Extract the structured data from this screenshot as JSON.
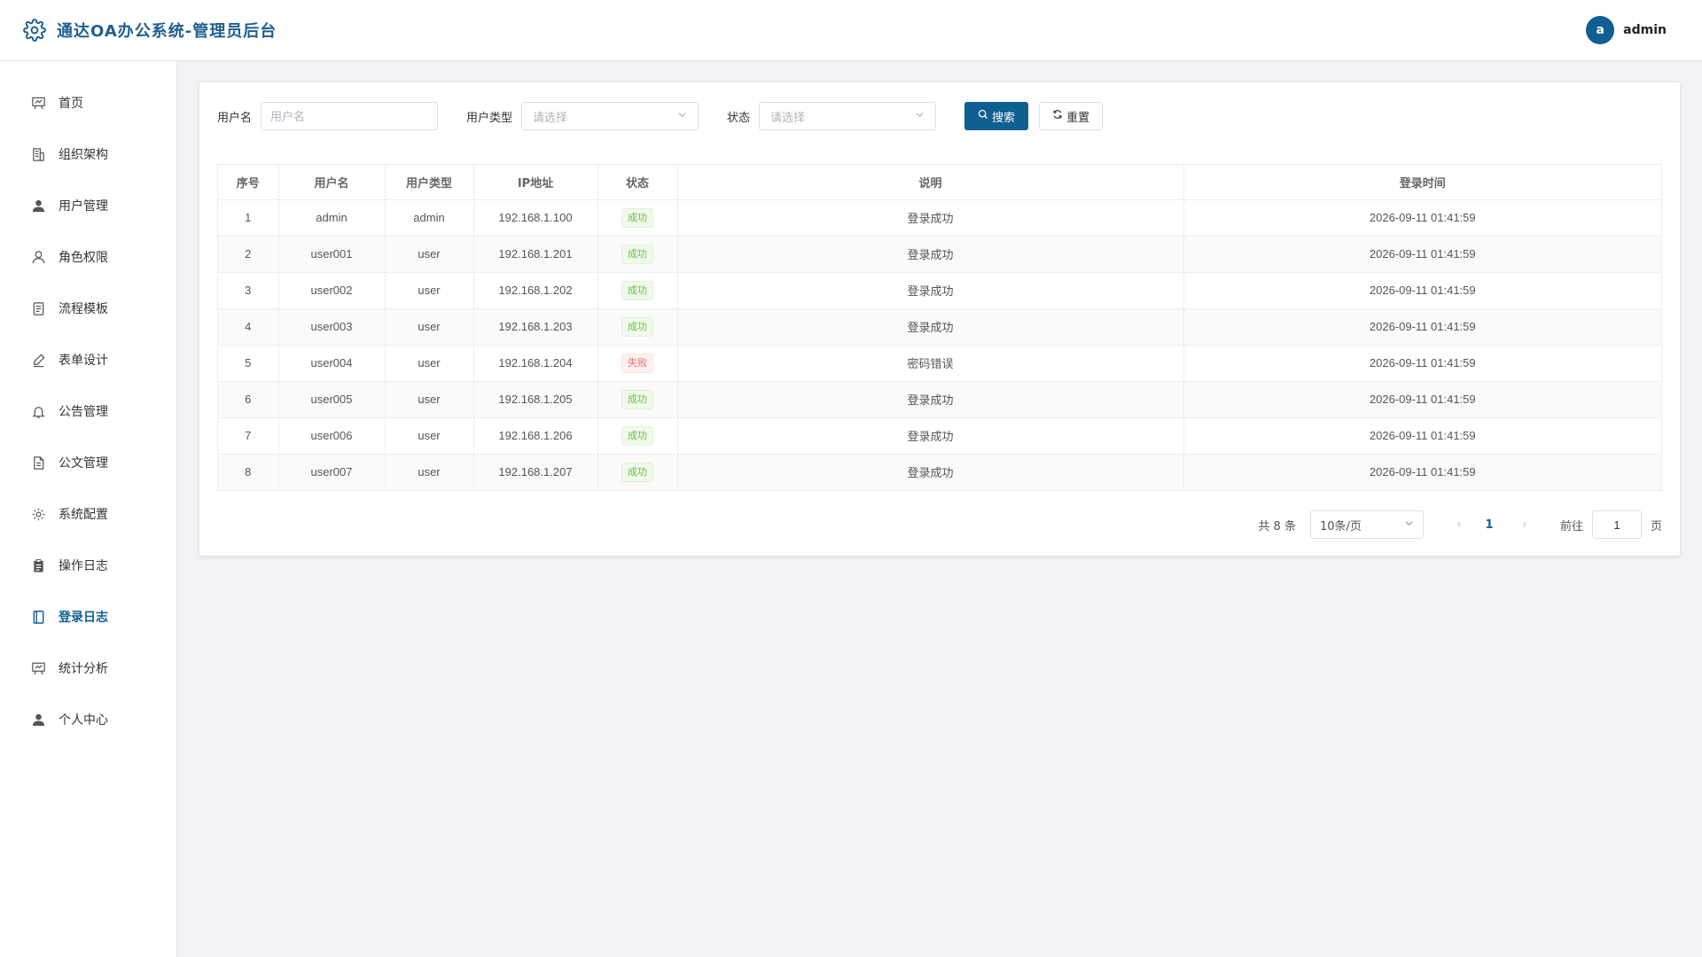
{
  "header": {
    "title": "通达OA办公系统-管理员后台",
    "user": {
      "avatar_letter": "a",
      "name": "admin"
    }
  },
  "sidebar": {
    "items": [
      {
        "label": "首页",
        "icon": "dashboard-icon"
      },
      {
        "label": "组织架构",
        "icon": "building-icon"
      },
      {
        "label": "用户管理",
        "icon": "user-filled-icon"
      },
      {
        "label": "角色权限",
        "icon": "user-outline-icon"
      },
      {
        "label": "流程模板",
        "icon": "document-icon"
      },
      {
        "label": "表单设计",
        "icon": "pen-icon"
      },
      {
        "label": "公告管理",
        "icon": "bell-icon"
      },
      {
        "label": "公文管理",
        "icon": "file-text-icon"
      },
      {
        "label": "系统配置",
        "icon": "gear-icon"
      },
      {
        "label": "操作日志",
        "icon": "clipboard-icon"
      },
      {
        "label": "登录日志",
        "icon": "notebook-icon",
        "active": true
      },
      {
        "label": "统计分析",
        "icon": "chart-board-icon"
      },
      {
        "label": "个人中心",
        "icon": "user-filled-icon"
      }
    ]
  },
  "filters": {
    "username": {
      "label": "用户名",
      "placeholder": "用户名",
      "value": ""
    },
    "user_type": {
      "label": "用户类型",
      "placeholder": "请选择"
    },
    "status": {
      "label": "状态",
      "placeholder": "请选择"
    },
    "search_label": "搜索",
    "reset_label": "重置"
  },
  "table": {
    "headers": [
      "序号",
      "用户名",
      "用户类型",
      "IP地址",
      "状态",
      "说明",
      "登录时间"
    ],
    "rows": [
      {
        "index": "1",
        "username": "admin",
        "user_type": "admin",
        "ip": "192.168.1.100",
        "status": "成功",
        "status_type": "success",
        "desc": "登录成功",
        "time": "2026-09-11 01:41:59"
      },
      {
        "index": "2",
        "username": "user001",
        "user_type": "user",
        "ip": "192.168.1.201",
        "status": "成功",
        "status_type": "success",
        "desc": "登录成功",
        "time": "2026-09-11 01:41:59"
      },
      {
        "index": "3",
        "username": "user002",
        "user_type": "user",
        "ip": "192.168.1.202",
        "status": "成功",
        "status_type": "success",
        "desc": "登录成功",
        "time": "2026-09-11 01:41:59"
      },
      {
        "index": "4",
        "username": "user003",
        "user_type": "user",
        "ip": "192.168.1.203",
        "status": "成功",
        "status_type": "success",
        "desc": "登录成功",
        "time": "2026-09-11 01:41:59"
      },
      {
        "index": "5",
        "username": "user004",
        "user_type": "user",
        "ip": "192.168.1.204",
        "status": "失败",
        "status_type": "danger",
        "desc": "密码错误",
        "time": "2026-09-11 01:41:59"
      },
      {
        "index": "6",
        "username": "user005",
        "user_type": "user",
        "ip": "192.168.1.205",
        "status": "成功",
        "status_type": "success",
        "desc": "登录成功",
        "time": "2026-09-11 01:41:59"
      },
      {
        "index": "7",
        "username": "user006",
        "user_type": "user",
        "ip": "192.168.1.206",
        "status": "成功",
        "status_type": "success",
        "desc": "登录成功",
        "time": "2026-09-11 01:41:59"
      },
      {
        "index": "8",
        "username": "user007",
        "user_type": "user",
        "ip": "192.168.1.207",
        "status": "成功",
        "status_type": "success",
        "desc": "登录成功",
        "time": "2026-09-11 01:41:59"
      }
    ]
  },
  "pagination": {
    "total_text": "共 8 条",
    "page_size": "10条/页",
    "current_page": "1",
    "goto_label": "前往",
    "goto_value": "1",
    "page_suffix": "页"
  },
  "colors": {
    "primary": "#0f5f93",
    "success": "#67c23a",
    "danger": "#f56c6c"
  }
}
